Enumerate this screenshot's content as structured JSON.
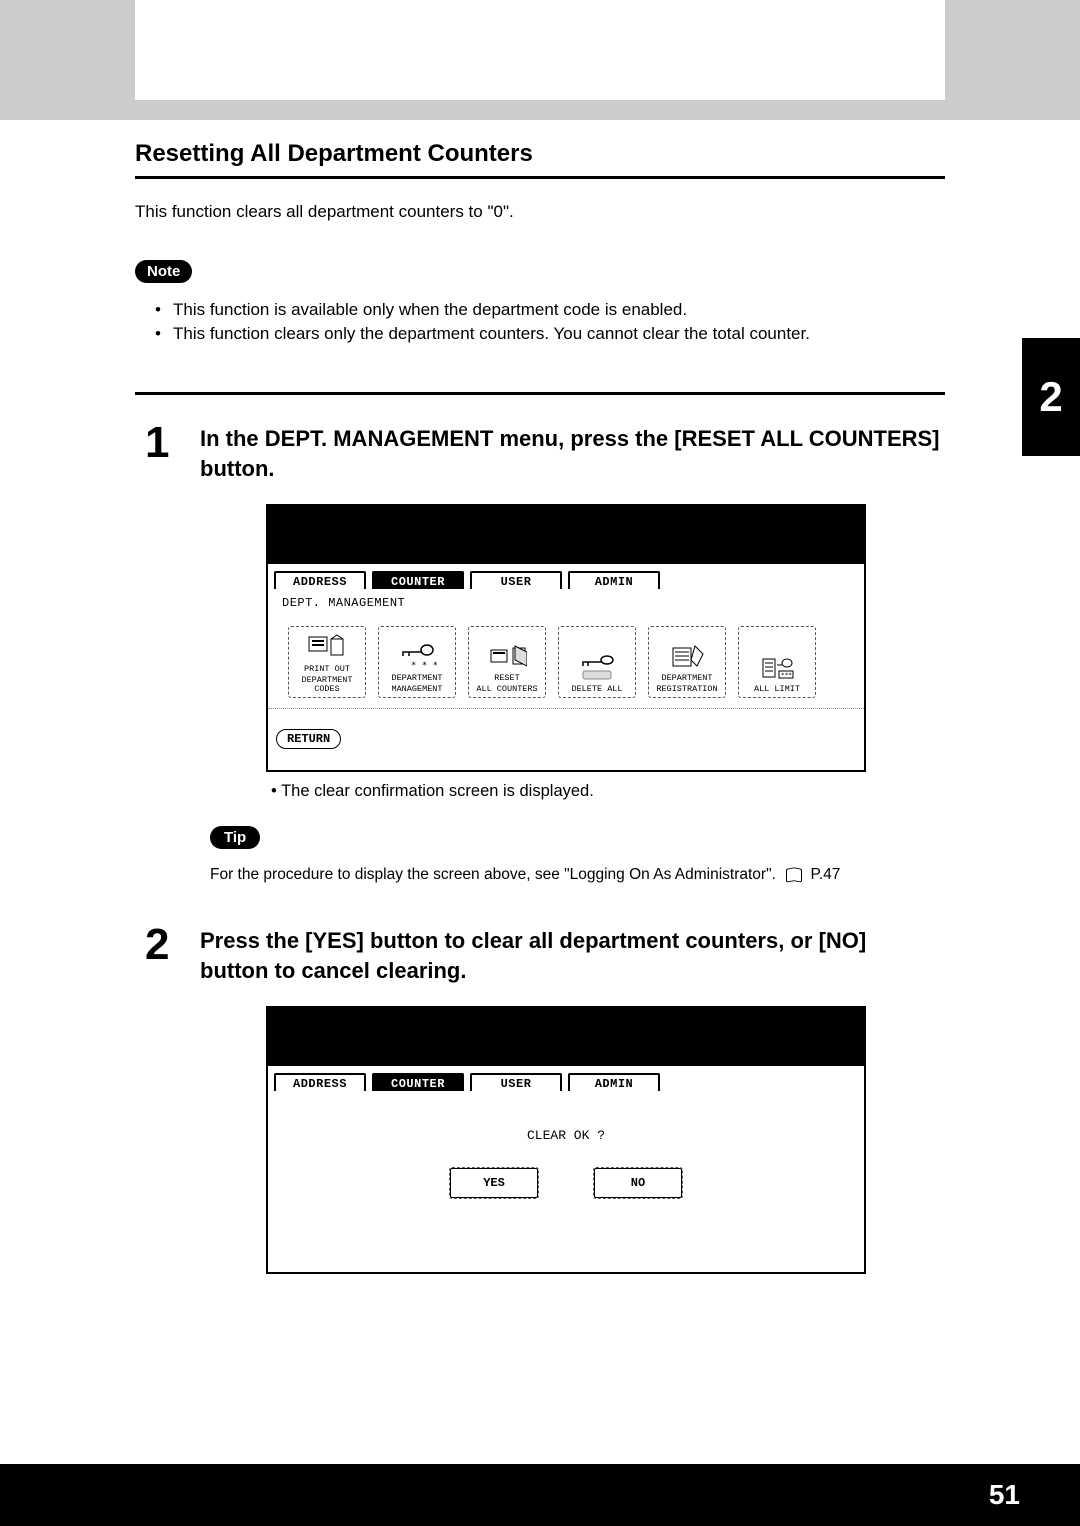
{
  "heading": "Resetting All Department Counters",
  "intro": "This function clears all department counters to \"0\".",
  "note_label": "Note",
  "note_items": [
    "This function is available only when the department code is enabled.",
    "This function clears only the department counters.  You cannot clear the total counter."
  ],
  "chapter_num": "2",
  "step1_num": "1",
  "step1_text": "In the DEPT. MANAGEMENT menu, press the [RESET ALL COUNTERS] button.",
  "tabs": {
    "address": "ADDRESS",
    "counter": "COUNTER",
    "user": "USER",
    "admin": "ADMIN"
  },
  "breadcrumb": "DEPT. MANAGEMENT",
  "panel_buttons": {
    "print_out": [
      "PRINT OUT",
      "DEPARTMENT CODES"
    ],
    "dept_mgmt": [
      "DEPARTMENT",
      "MANAGEMENT"
    ],
    "reset_all": [
      "RESET",
      "ALL COUNTERS"
    ],
    "delete_all": [
      "DELETE ALL"
    ],
    "dept_reg": [
      "DEPARTMENT",
      "REGISTRATION"
    ],
    "all_limit": [
      "ALL LIMIT"
    ]
  },
  "return_label": "RETURN",
  "after1": "The clear confirmation screen is displayed.",
  "tip_label": "Tip",
  "tip_text": "For the procedure to display the screen above, see \"Logging On As Administrator\".",
  "tip_page": "P.47",
  "step2_num": "2",
  "step2_text": "Press the [YES] button to clear all department counters, or [NO] button to cancel clearing.",
  "clear_ok": "CLEAR OK ?",
  "yes_label": "YES",
  "no_label": "NO",
  "page_number": "51"
}
